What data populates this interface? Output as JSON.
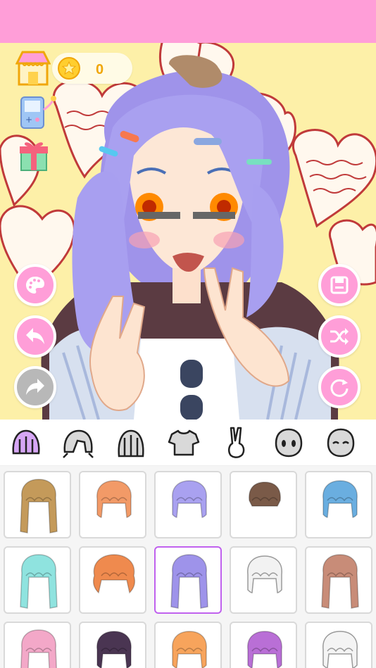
{
  "header": {
    "color": "#ff9ed8"
  },
  "wallet": {
    "coins": "0",
    "coin_icon": "star-coin-icon"
  },
  "left_icons": [
    "shop-icon",
    "game-console-icon",
    "gift-icon"
  ],
  "side_buttons": {
    "left": [
      "palette-icon",
      "undo-icon",
      "redo-icon"
    ],
    "right": [
      "save-icon",
      "shuffle-icon",
      "reset-icon"
    ]
  },
  "tabs": [
    {
      "icon": "hair-front-icon",
      "selected": true
    },
    {
      "icon": "hair-back-icon"
    },
    {
      "icon": "hair-long-icon"
    },
    {
      "icon": "shirt-icon"
    },
    {
      "icon": "pose-hand-icon"
    },
    {
      "icon": "face-icon"
    },
    {
      "icon": "face-blush-icon"
    }
  ],
  "hair_items": [
    {
      "color": "#c49a5a",
      "style": "braids"
    },
    {
      "color": "#f29a67",
      "style": "short"
    },
    {
      "color": "#a9a1f0",
      "style": "bob"
    },
    {
      "color": "#7a5a48",
      "style": "mushroom"
    },
    {
      "color": "#6aaee0",
      "style": "spiky"
    },
    {
      "color": "#8fe3df",
      "style": "long"
    },
    {
      "color": "#ef8a4e",
      "style": "curly"
    },
    {
      "color": "#9e93ea",
      "style": "side",
      "selected": true
    },
    {
      "color": "#f2f2f2",
      "style": "bun"
    },
    {
      "color": "#c88c78",
      "style": "straight"
    },
    {
      "color": "#f3a8c8",
      "style": "wavy"
    },
    {
      "color": "#4a3552",
      "style": "twintail"
    },
    {
      "color": "#f7a45c",
      "style": "soft"
    },
    {
      "color": "#b96fd6",
      "style": "bunhigh"
    },
    {
      "color": "#f4f4f4",
      "style": "loose"
    }
  ],
  "colors": {
    "accent": "#ff9ed8",
    "selected_border": "#c061ee",
    "stage_bg": "#fdf0a8"
  }
}
